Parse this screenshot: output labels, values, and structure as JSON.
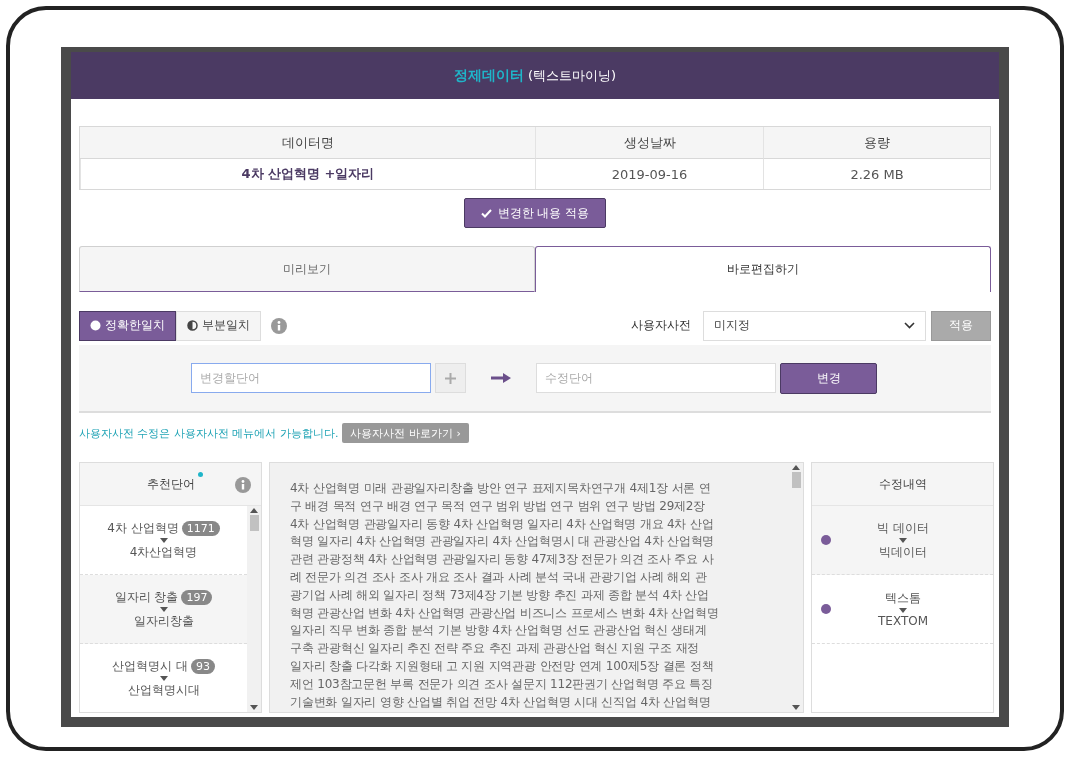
{
  "header": {
    "title": "정제데이터",
    "subtitle": "(텍스트마이닝)"
  },
  "data_table": {
    "columns": [
      "데이터명",
      "생성날짜",
      "용량"
    ],
    "row": [
      "4차 산업혁명 +일자리",
      "2019-09-16",
      "2.26 MB"
    ]
  },
  "apply_changes_button": "변경한 내용 적용",
  "tabs": [
    {
      "label": "미리보기",
      "selected": false
    },
    {
      "label": "바로편집하기",
      "selected": true
    }
  ],
  "match_modes": [
    {
      "label": "정확한일치",
      "selected": true
    },
    {
      "label": "부분일치",
      "selected": false
    }
  ],
  "user_dictionary": {
    "label": "사용자사전",
    "value": "미지정",
    "apply": "적용"
  },
  "replace": {
    "from_placeholder": "변경할단어",
    "to_placeholder": "수정단어",
    "button": "변경"
  },
  "hint": {
    "text": "사용자사전 수정은 사용자사전 메뉴에서 가능합니다.",
    "link": "사용자사전 바로가기 ›"
  },
  "recommended": {
    "title": "추천단어",
    "items": [
      {
        "word": "4차 산업혁명",
        "count": "1171",
        "suggestion": "4차산업혁명"
      },
      {
        "word": "일자리 창출",
        "count": "197",
        "suggestion": "일자리창출"
      },
      {
        "word": "산업혁명시 대",
        "count": "93",
        "suggestion": "산업혁명시대"
      }
    ]
  },
  "text_lines": [
    "4차 산업혁명 미래 관광일자리창출 방안 연구 표제지목차연구개 4제1장 서론 연",
    "구 배경 목적 연구 배경 연구 목적 연구 범위 방법 연구 범위 연구 방법 29제2장",
    "4차 산업혁명 관광일자리 동향 4차 산업혁명 일자리 4차 산업혁명 개요 4차 산업",
    "혁명 일자리 4차 산업혁명 관광일자리 4차 산업혁명시 대 관광산업 4차 산업혁명",
    "관련 관광정책 4차 산업혁명 관광일자리 동향 47제3장 전문가 의견 조사 주요 사",
    "례 전문가 의견 조사 조사 개요 조사 결과 사례 분석 국내 관광기업 사례 해외 관",
    "광기업 사례 해외 일자리 정책 73제4장 기본 방향 추진 과제 종합 분석 4차 산업",
    "혁명 관광산업 변화 4차 산업혁명 관광산업 비즈니스 프로세스 변화 4차 산업혁명",
    "일자리 직무 변화 종합 분석 기본 방향 4차 산업혁명 선도 관광산업 혁신 생태계",
    "구축 관광혁신 일자리 추진 전략 주요 추진 과제 관광산업 혁신 지원 구조 재정",
    "일자리 창출 다각화 지원형태 고 지원 지역관광 안전망 연계 100제5장 결론 정책",
    "제언 103참고문헌 부록 전문가 의견 조사 설문지 112판권기 산업혁명 주요 특징",
    "기술변화 일자리 영향 산업별 취업 전망 4차 산업혁명 시대 신직업 4차 산업혁명"
  ],
  "history": {
    "title": "수정내역",
    "items": [
      {
        "from": "빅 데이터",
        "to": "빅데이터",
        "color": "#7a5c99"
      },
      {
        "from": "텍스톰",
        "to": "TEXTOM",
        "color": "#7a5c99"
      }
    ]
  }
}
